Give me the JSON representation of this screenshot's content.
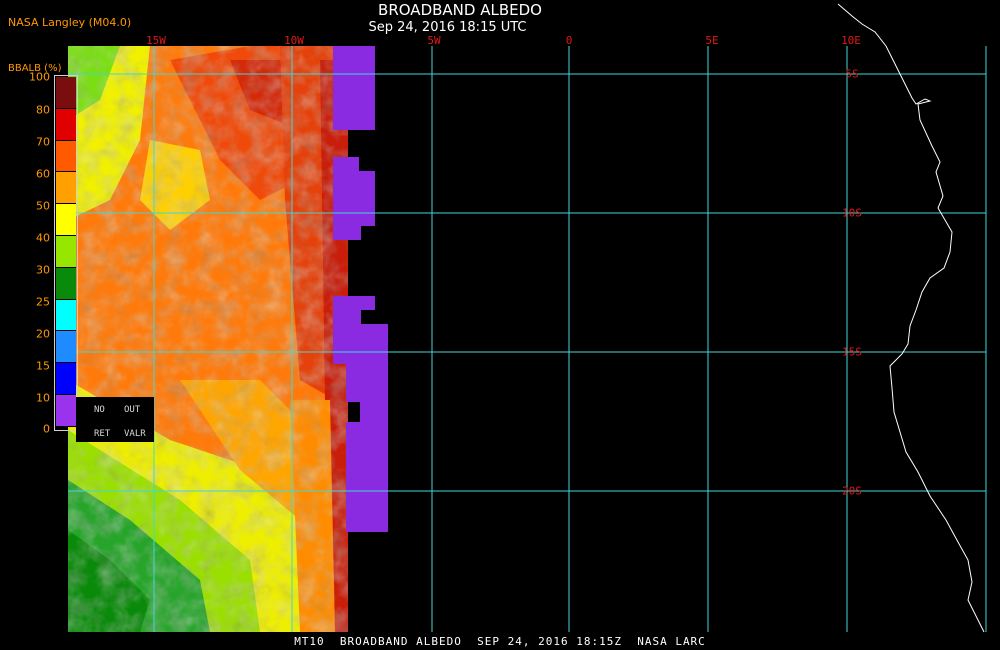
{
  "header": {
    "agency": "NASA Langley (M04.0)",
    "title": "BROADBAND ALBEDO",
    "subtitle": "Sep 24, 2016 18:15 UTC"
  },
  "longitude_labels": [
    "15W",
    "10W",
    "5W",
    "0",
    "5E",
    "10E"
  ],
  "latitude_labels": [
    "5S",
    "10S",
    "15S",
    "20S"
  ],
  "colorbar": {
    "title": "BBALB (%)",
    "ticks": [
      "100",
      "80",
      "70",
      "60",
      "50",
      "40",
      "30",
      "25",
      "20",
      "15",
      "10",
      "0"
    ],
    "colors": [
      "#7a0d0d",
      "#e00000",
      "#ff5a00",
      "#ff9f00",
      "#ffff00",
      "#96e600",
      "#0a8a0a",
      "#00ffff",
      "#1e8cff",
      "#0000ff",
      "#9933ee"
    ],
    "no_ret": [
      "NO",
      "RET"
    ],
    "out_valr": [
      "OUT",
      "VALR"
    ]
  },
  "colors": {
    "grid": "#3fd8d8",
    "coast": "#ffffff",
    "label_red": "#e01818",
    "label_orange": "#ff9900",
    "out_of_range": "#8a2be2"
  },
  "footer": "MT10  BROADBAND ALBEDO  SEP 24, 2016 18:15Z  NASA LARC"
}
